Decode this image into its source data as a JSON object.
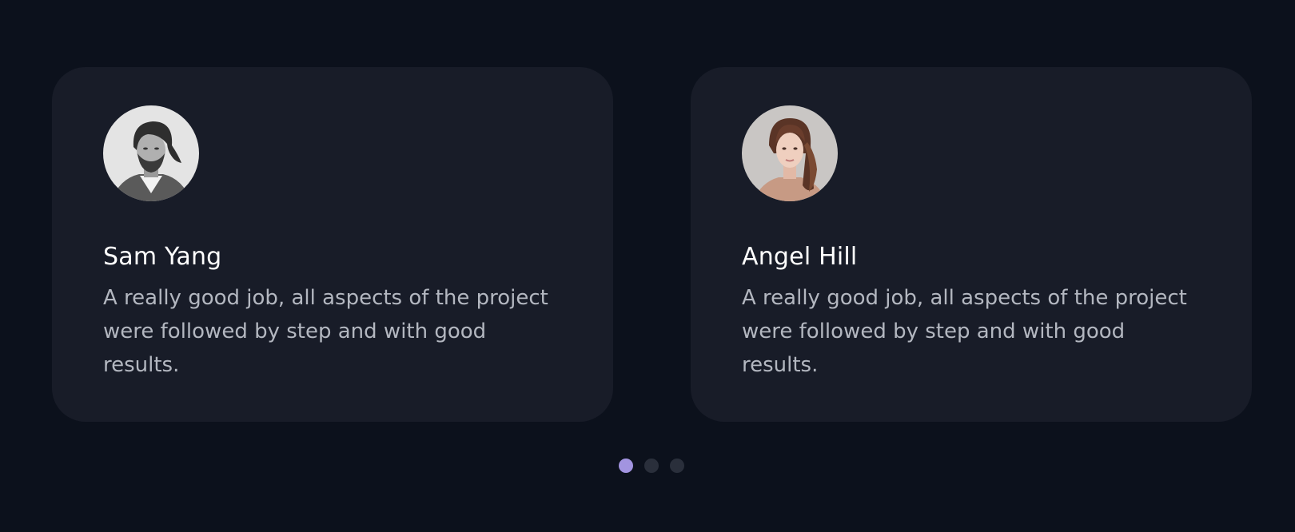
{
  "testimonials": [
    {
      "name": "Sam Yang",
      "quote": "A really good job, all aspects of the project were followed by step and with good results.",
      "avatar_icon": "person-photo-male"
    },
    {
      "name": "Angel Hill",
      "quote": "A really good job, all aspects of the project were followed by step and with good results.",
      "avatar_icon": "person-photo-female"
    }
  ],
  "pagination": {
    "count": 3,
    "active_index": 0
  },
  "colors": {
    "background": "#0c111c",
    "card": "#181c28",
    "name": "#ffffff",
    "quote": "#b3b7c0",
    "dot_active": "#a294e0",
    "dot_inactive": "#2a2f3b"
  }
}
